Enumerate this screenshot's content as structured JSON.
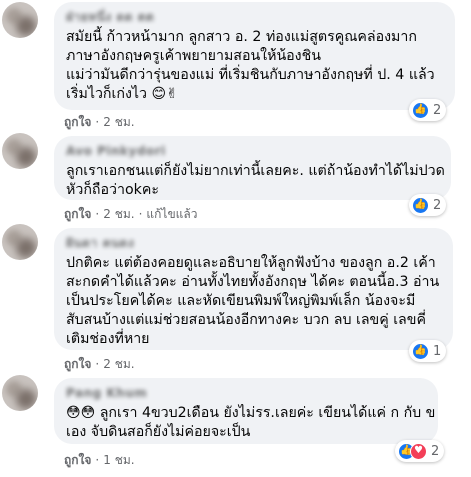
{
  "comments": [
    {
      "author": "ฝ่ายหนึ่ง ดด ตต",
      "lines": [
        "สมัยนี้ ก้าวหน้ามาก ลูกสาว อ. 2 ท่องแม่สูตรคูณคล่องมาก",
        "ภาษาอังกฤษครูเค้าพยายามสอนให้น้องชิน",
        "แม่ว่ามันดีกว่ารุ่นของแม่ ที่เริ่มชินกับภาษาอังกฤษที่ ป. 4 แล้ว",
        "เริ่มไวก็เก่งไว"
      ],
      "emoji": "😊✌",
      "like_label": "ถูกใจ",
      "time": "2 ชม.",
      "edited": "",
      "reactions": {
        "types": [
          "like"
        ],
        "count": "2"
      }
    },
    {
      "author": "Avo Pinkydori",
      "lines": [
        "ลูกเราเอกชนแต่ก็ยังไม่ยากเท่านี้เลยคะ. แต่ถ้าน้องทำได้ไม่ปวด",
        "หัวก็ถือว่าokคะ"
      ],
      "emoji": "",
      "like_label": "ถูกใจ",
      "time": "2 ชม.",
      "edited": "แก้ไขแล้ว",
      "reactions": {
        "types": [
          "like"
        ],
        "count": "2"
      }
    },
    {
      "author": "ฝันดา คนดง",
      "lines": [
        "ปกติคะ แต่ต้องคอยดูและอธิบายให้ลูกฟังบ้าง ของลูก อ.2 เค้า",
        "สะกดคำได้แล้วคะ อ่านทั้งไทยทั้งอังกฤษ ได้คะ ตอนนี้อ.3 อ่าน",
        "เป็นประโยคได้คะ และหัดเขียนพิมพ์ใหญ่พิมพ์เล็ก น้องจะมี",
        "สับสนบ้างแต่แม่ช่วยสอนน้องอีกทางคะ บวก ลบ เลขคู่ เลขคี่",
        "เติมช่องที่หาย"
      ],
      "emoji": "",
      "like_label": "ถูกใจ",
      "time": "2 ชม.",
      "edited": "",
      "reactions": {
        "types": [
          "like"
        ],
        "count": "1"
      }
    },
    {
      "author": "Pang Khum",
      "lines": [
        "ลูกเรา 4ขวบ2เดือน ยังไม่รร.เลยค่ะ เขียนได้แค่ ก กับ ข",
        "เอง จับดินสอก็ยังไม่ค่อยจะเป็น"
      ],
      "emoji": "😳😳",
      "like_label": "ถูกใจ",
      "time": "1 ชม.",
      "edited": "",
      "reactions": {
        "types": [
          "like",
          "love"
        ],
        "count": "2"
      }
    }
  ],
  "colors": {
    "bubble": "#f0f2f5",
    "meta_text": "#65676b",
    "like_blue": "#1877f2",
    "love_red": "#f33e58"
  },
  "icons": {
    "like": "thumbs-up-icon",
    "love": "heart-icon"
  }
}
